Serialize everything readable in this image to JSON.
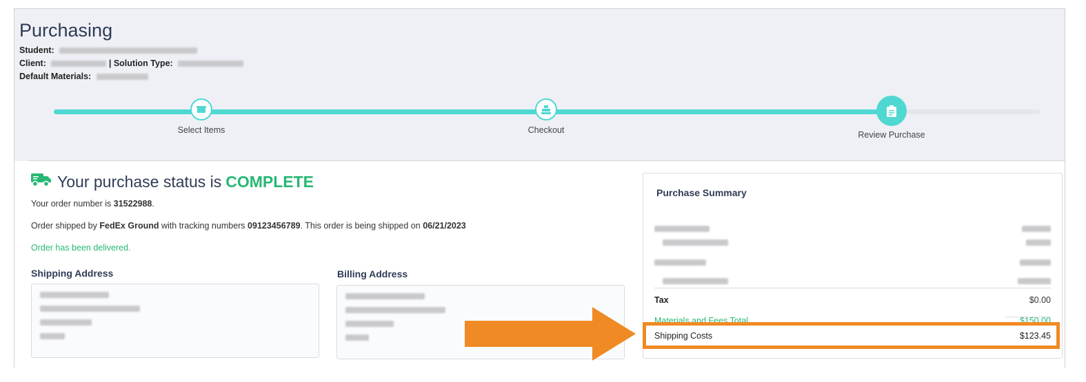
{
  "header": {
    "title": "Purchasing",
    "student_label": "Student:",
    "client_label": "Client:",
    "solution_type_label": "| Solution Type:",
    "default_materials_label": "Default Materials:"
  },
  "stepper": {
    "steps": [
      {
        "label": "Select Items",
        "icon": "store-icon"
      },
      {
        "label": "Checkout",
        "icon": "register-icon"
      },
      {
        "label": "Review Purchase",
        "icon": "clipboard-icon"
      }
    ],
    "progress_fraction": 0.85
  },
  "status": {
    "prefix": "Your purchase status is",
    "value": "COMPLETE",
    "order_prefix": "Your order number is",
    "order_number": "31522988",
    "shipped_by_prefix": "Order shipped by",
    "carrier": "FedEx Ground",
    "tracking_prefix": "with tracking numbers",
    "tracking_number": "09123456789",
    "ship_date_prefix": ". This order is being shipped on",
    "ship_date": "06/21/2023",
    "delivered": "Order has been delivered."
  },
  "shipping_address": {
    "heading": "Shipping Address"
  },
  "billing_address": {
    "heading": "Billing Address"
  },
  "summary": {
    "title": "Purchase Summary",
    "tax_label": "Tax",
    "tax_value": "$0.00",
    "materials_total_label": "Materials and Fees Total",
    "materials_total_value": "$150.00",
    "shipping_label": "Shipping Costs",
    "shipping_value": "$123.45"
  },
  "colors": {
    "accent": "#4fd8d2",
    "success": "#27b874",
    "highlight": "#f08a24",
    "heading": "#2f3b55"
  }
}
